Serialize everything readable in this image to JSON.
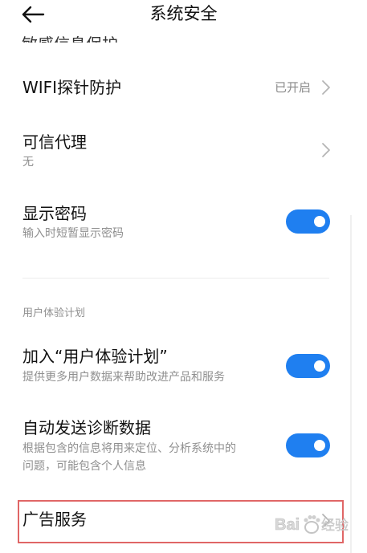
{
  "header": {
    "title": "系统安全"
  },
  "cut_row": {
    "label": "敏感信息保护"
  },
  "rows": {
    "wifi": {
      "title": "WIFI探针防护",
      "value": "已开启"
    },
    "trusted_agent": {
      "title": "可信代理",
      "subtitle": "无"
    },
    "show_password": {
      "title": "显示密码",
      "subtitle": "输入时短暂显示密码",
      "enabled": true
    },
    "ux_plan": {
      "title": "加入“用户体验计划”",
      "subtitle": "提供更多用户数据来帮助改进产品和服务",
      "enabled": true
    },
    "diagnostics": {
      "title": "自动发送诊断数据",
      "subtitle_line1": "根据包含的信息将用来定位、分析系统中的",
      "subtitle_line2": "问题，可能包含个人信息",
      "enabled": true
    },
    "ad_service": {
      "title": "广告服务"
    }
  },
  "section": {
    "label": "用户体验计划"
  },
  "colors": {
    "toggle_on": "#1f7ff0",
    "highlight": "#e06666"
  },
  "icons": {
    "back": "arrow-left-icon",
    "chevron": "chevron-right-icon"
  },
  "watermark": {
    "text": "Baidu 经验"
  }
}
